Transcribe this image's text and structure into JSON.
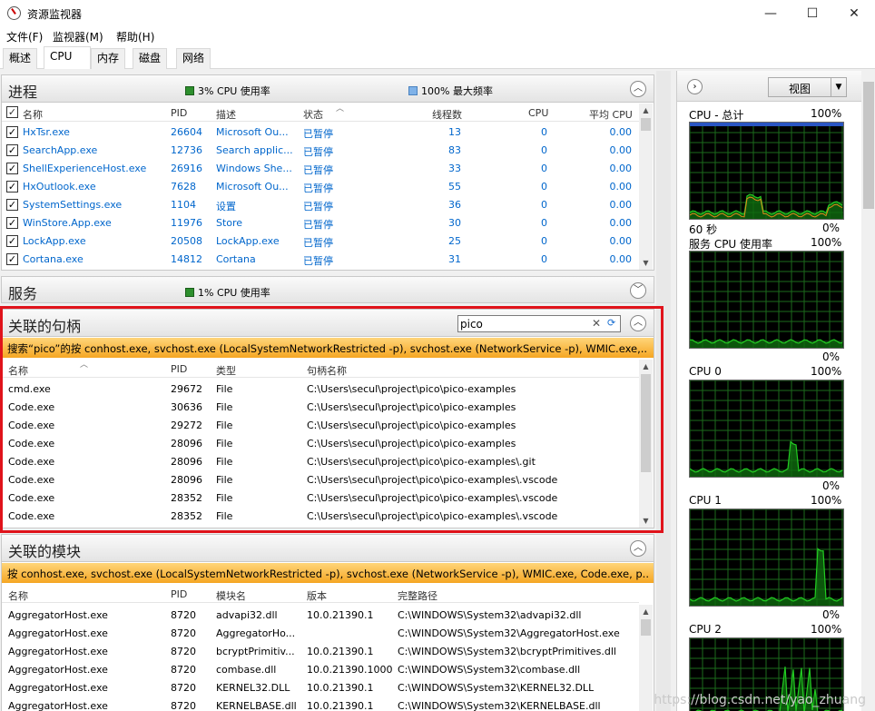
{
  "window": {
    "title": "资源监视器",
    "minimize": "—",
    "maximize": "☐",
    "close": "✕"
  },
  "menu": [
    "文件(F)",
    "监视器(M)",
    "帮助(H)"
  ],
  "tabs": [
    "概述",
    "CPU",
    "内存",
    "磁盘",
    "网络"
  ],
  "active_tab": "CPU",
  "processes": {
    "title": "进程",
    "cpu_usage": "3% CPU 使用率",
    "max_freq": "100% 最大频率",
    "columns": [
      "名称",
      "PID",
      "描述",
      "状态",
      "线程数",
      "CPU",
      "平均 CPU"
    ],
    "rows": [
      [
        "HxTsr.exe",
        "26604",
        "Microsoft Ou...",
        "已暂停",
        "13",
        "0",
        "0.00"
      ],
      [
        "SearchApp.exe",
        "12736",
        "Search applic...",
        "已暂停",
        "83",
        "0",
        "0.00"
      ],
      [
        "ShellExperienceHost.exe",
        "26916",
        "Windows She...",
        "已暂停",
        "33",
        "0",
        "0.00"
      ],
      [
        "HxOutlook.exe",
        "7628",
        "Microsoft Ou...",
        "已暂停",
        "55",
        "0",
        "0.00"
      ],
      [
        "SystemSettings.exe",
        "1104",
        "设置",
        "已暂停",
        "36",
        "0",
        "0.00"
      ],
      [
        "WinStore.App.exe",
        "11976",
        "Store",
        "已暂停",
        "30",
        "0",
        "0.00"
      ],
      [
        "LockApp.exe",
        "20508",
        "LockApp.exe",
        "已暂停",
        "25",
        "0",
        "0.00"
      ],
      [
        "Cortana.exe",
        "14812",
        "Cortana",
        "已暂停",
        "31",
        "0",
        "0.00"
      ]
    ]
  },
  "services": {
    "title": "服务",
    "cpu_usage": "1% CPU 使用率"
  },
  "handles": {
    "title": "关联的句柄",
    "search_value": "pico",
    "filter": "搜索“pico”的按 conhost.exe, svchost.exe (LocalSystemNetworkRestricted -p), svchost.exe (NetworkService -p), WMIC.exe,...",
    "columns": [
      "名称",
      "PID",
      "类型",
      "句柄名称"
    ],
    "rows": [
      [
        "cmd.exe",
        "29672",
        "File",
        "C:\\Users\\secul\\project\\pico\\pico-examples"
      ],
      [
        "Code.exe",
        "30636",
        "File",
        "C:\\Users\\secul\\project\\pico\\pico-examples"
      ],
      [
        "Code.exe",
        "29272",
        "File",
        "C:\\Users\\secul\\project\\pico\\pico-examples"
      ],
      [
        "Code.exe",
        "28096",
        "File",
        "C:\\Users\\secul\\project\\pico\\pico-examples"
      ],
      [
        "Code.exe",
        "28096",
        "File",
        "C:\\Users\\secul\\project\\pico\\pico-examples\\.git"
      ],
      [
        "Code.exe",
        "28096",
        "File",
        "C:\\Users\\secul\\project\\pico\\pico-examples\\.vscode"
      ],
      [
        "Code.exe",
        "28352",
        "File",
        "C:\\Users\\secul\\project\\pico\\pico-examples\\.vscode"
      ],
      [
        "Code.exe",
        "28352",
        "File",
        "C:\\Users\\secul\\project\\pico\\pico-examples\\.vscode"
      ]
    ]
  },
  "modules": {
    "title": "关联的模块",
    "filter": "按 conhost.exe, svchost.exe (LocalSystemNetworkRestricted -p), svchost.exe (NetworkService -p), WMIC.exe, Code.exe, p...",
    "columns": [
      "名称",
      "PID",
      "模块名",
      "版本",
      "完整路径"
    ],
    "rows": [
      [
        "AggregatorHost.exe",
        "8720",
        "advapi32.dll",
        "10.0.21390.1",
        "C:\\WINDOWS\\System32\\advapi32.dll"
      ],
      [
        "AggregatorHost.exe",
        "8720",
        "AggregatorHo...",
        "",
        "C:\\WINDOWS\\System32\\AggregatorHost.exe"
      ],
      [
        "AggregatorHost.exe",
        "8720",
        "bcryptPrimitiv...",
        "10.0.21390.1",
        "C:\\WINDOWS\\System32\\bcryptPrimitives.dll"
      ],
      [
        "AggregatorHost.exe",
        "8720",
        "combase.dll",
        "10.0.21390.1000",
        "C:\\WINDOWS\\System32\\combase.dll"
      ],
      [
        "AggregatorHost.exe",
        "8720",
        "KERNEL32.DLL",
        "10.0.21390.1",
        "C:\\WINDOWS\\System32\\KERNEL32.DLL"
      ],
      [
        "AggregatorHost.exe",
        "8720",
        "KERNELBASE.dll",
        "10.0.21390.1",
        "C:\\WINDOWS\\System32\\KERNELBASE.dll"
      ]
    ]
  },
  "right_pane": {
    "view_label": "视图",
    "graphs": [
      {
        "title": "CPU - 总计",
        "max": "100%",
        "bottom_left": "60 秒",
        "bottom_right": "0%"
      },
      {
        "title": "服务 CPU 使用率",
        "max": "100%",
        "bottom_left": "",
        "bottom_right": "0%"
      },
      {
        "title": "CPU 0",
        "max": "100%",
        "bottom_left": "",
        "bottom_right": "0%"
      },
      {
        "title": "CPU 1",
        "max": "100%",
        "bottom_left": "",
        "bottom_right": "0%"
      },
      {
        "title": "CPU 2",
        "max": "100%",
        "bottom_left": "",
        "bottom_right": ""
      }
    ]
  },
  "watermark": "https://blog.csdn.net/yao_zhuang",
  "colors": {
    "accent_red": "#e0131b",
    "filter_orange": "#f5a623",
    "link_blue": "#0066cc",
    "graph_green": "#22cc22"
  }
}
